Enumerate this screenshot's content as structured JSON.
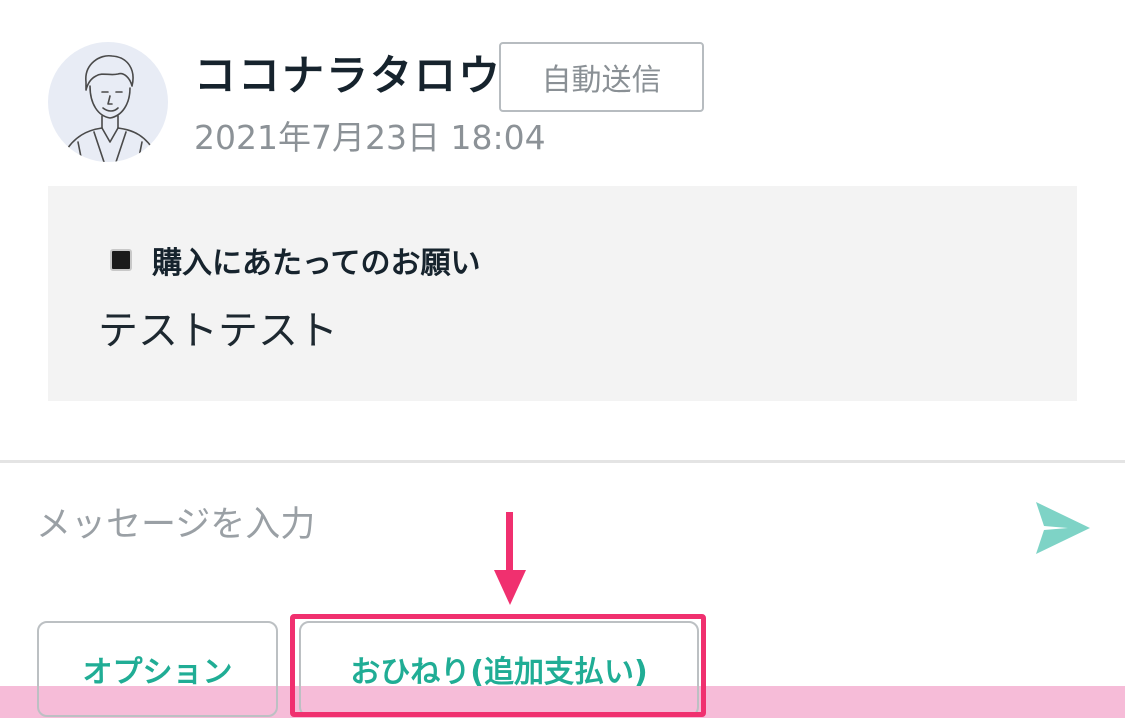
{
  "message": {
    "sender_name": "ココナラタロウ",
    "badge": "自動送信",
    "timestamp": "2021年7月23日 18:04",
    "heading": "購入にあたってのお願い",
    "body": "テストテスト"
  },
  "composer": {
    "placeholder": "メッセージを入力"
  },
  "actions": {
    "option_label": "オプション",
    "tip_label": "おひねり(追加支払い)"
  },
  "icons": {
    "avatar": "avatar-illustration",
    "heading_marker": "black-square-icon",
    "send": "send-icon",
    "annotation": "down-arrow-icon"
  },
  "colors": {
    "accent": "#20ad95",
    "send_icon": "#7ed3c6",
    "annotation": "#f0306f",
    "bottom_band": "#f6bcd8"
  }
}
